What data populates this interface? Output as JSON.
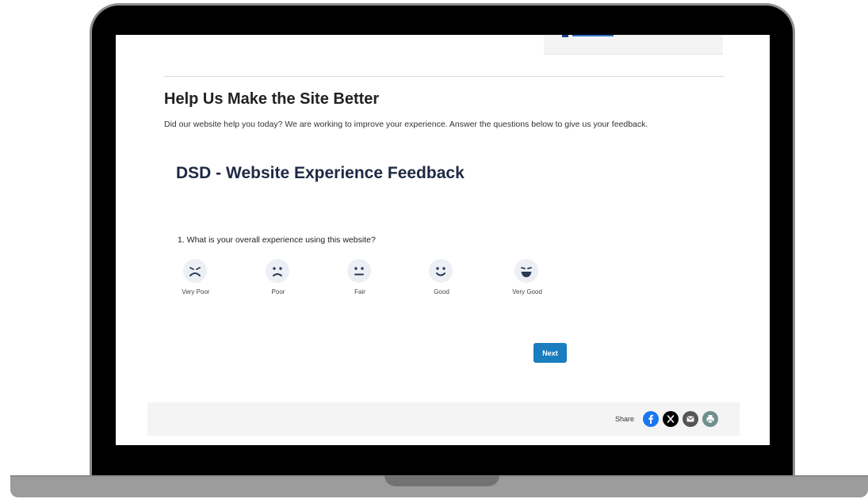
{
  "section": {
    "title": "Help Us Make the Site Better",
    "description": "Did our website help you today? We are working to improve your experience. Answer the questions below to give us your feedback."
  },
  "survey": {
    "title": "DSD - Website Experience Feedback",
    "question": "1.  What is your overall experience using this website?",
    "ratings": [
      {
        "label": "Very Poor",
        "icon": "very-sad-face-icon"
      },
      {
        "label": "Poor",
        "icon": "sad-face-icon"
      },
      {
        "label": "Fair",
        "icon": "neutral-face-icon"
      },
      {
        "label": "Good",
        "icon": "smile-face-icon"
      },
      {
        "label": "Very Good",
        "icon": "big-smile-face-icon"
      }
    ],
    "next_label": "Next"
  },
  "share": {
    "label": "Share",
    "buttons": [
      {
        "icon": "facebook-icon",
        "color": "#1877f2"
      },
      {
        "icon": "x-icon",
        "color": "#000000"
      },
      {
        "icon": "email-icon",
        "color": "#555555"
      },
      {
        "icon": "print-icon",
        "color": "#6f8f8f"
      }
    ]
  },
  "colors": {
    "accent": "#1a7dbf",
    "title": "#1e2a44",
    "face_bg": "#eceff4"
  }
}
